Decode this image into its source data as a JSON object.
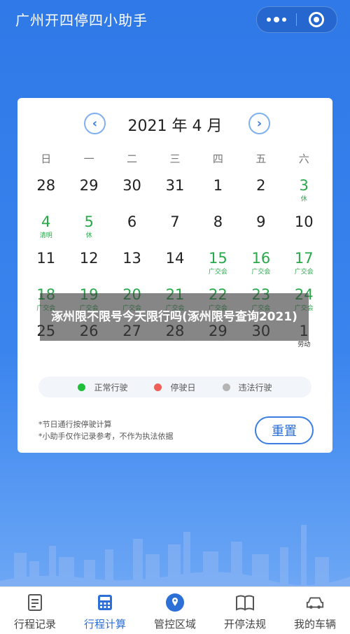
{
  "app": {
    "title": "广州开四停四小助手"
  },
  "calendar": {
    "month_label": "2021 年 4 月",
    "weekdays": [
      "日",
      "一",
      "二",
      "三",
      "四",
      "五",
      "六"
    ],
    "weeks": [
      [
        {
          "n": "28",
          "s": "",
          "c": "normal"
        },
        {
          "n": "29",
          "s": "",
          "c": "normal"
        },
        {
          "n": "30",
          "s": "",
          "c": "normal"
        },
        {
          "n": "31",
          "s": "",
          "c": "normal"
        },
        {
          "n": "1",
          "s": "",
          "c": "normal"
        },
        {
          "n": "2",
          "s": "",
          "c": "normal"
        },
        {
          "n": "3",
          "s": "休",
          "c": "green"
        }
      ],
      [
        {
          "n": "4",
          "s": "清明",
          "c": "green"
        },
        {
          "n": "5",
          "s": "休",
          "c": "green"
        },
        {
          "n": "6",
          "s": "",
          "c": "normal"
        },
        {
          "n": "7",
          "s": "",
          "c": "normal"
        },
        {
          "n": "8",
          "s": "",
          "c": "normal"
        },
        {
          "n": "9",
          "s": "",
          "c": "normal"
        },
        {
          "n": "10",
          "s": "",
          "c": "normal"
        }
      ],
      [
        {
          "n": "11",
          "s": "",
          "c": "normal"
        },
        {
          "n": "12",
          "s": "",
          "c": "normal"
        },
        {
          "n": "13",
          "s": "",
          "c": "normal"
        },
        {
          "n": "14",
          "s": "",
          "c": "normal"
        },
        {
          "n": "15",
          "s": "广交会",
          "c": "green"
        },
        {
          "n": "16",
          "s": "广交会",
          "c": "green"
        },
        {
          "n": "17",
          "s": "广交会",
          "c": "green"
        }
      ],
      [
        {
          "n": "18",
          "s": "广交会",
          "c": "green"
        },
        {
          "n": "19",
          "s": "广交会",
          "c": "green"
        },
        {
          "n": "20",
          "s": "广交会",
          "c": "green"
        },
        {
          "n": "21",
          "s": "广交会",
          "c": "green"
        },
        {
          "n": "22",
          "s": "广交会",
          "c": "green"
        },
        {
          "n": "23",
          "s": "广交会",
          "c": "green"
        },
        {
          "n": "24",
          "s": "广交会",
          "c": "green"
        }
      ],
      [
        {
          "n": "25",
          "s": "",
          "c": "normal"
        },
        {
          "n": "26",
          "s": "",
          "c": "normal"
        },
        {
          "n": "27",
          "s": "",
          "c": "normal"
        },
        {
          "n": "28",
          "s": "",
          "c": "normal"
        },
        {
          "n": "29",
          "s": "",
          "c": "normal"
        },
        {
          "n": "30",
          "s": "",
          "c": "normal"
        },
        {
          "n": "1",
          "s": "劳动",
          "c": "normal"
        }
      ]
    ]
  },
  "legend": {
    "normal": "正常行驶",
    "stop": "停驶日",
    "violation": "违法行驶",
    "colors": {
      "normal": "#1fbf3a",
      "stop": "#f0605a",
      "violation": "#b5b5b5",
      "green_day": "#29a84a"
    }
  },
  "notes": {
    "line1": "*节日通行按停驶计算",
    "line2": "*小助手仅作记录参考，不作为执法依据"
  },
  "reset_label": "重置",
  "overlay_caption": "涿州限不限号今天限行吗(涿州限号查询2021)",
  "tabs": [
    {
      "label": "行程记录",
      "icon": "document-icon"
    },
    {
      "label": "行程计算",
      "icon": "calculator-icon"
    },
    {
      "label": "管控区域",
      "icon": "location-badge-icon"
    },
    {
      "label": "开停法规",
      "icon": "book-icon"
    },
    {
      "label": "我的车辆",
      "icon": "car-icon"
    }
  ],
  "colors": {
    "accent": "#2c6fd6",
    "background": "#3a84ee"
  }
}
